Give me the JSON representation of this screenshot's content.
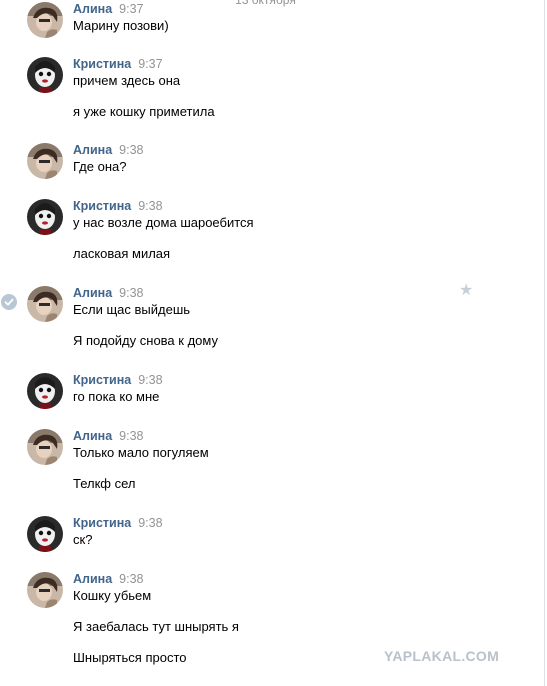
{
  "date_separator": "13 октября",
  "messages": [
    {
      "author": "Алина",
      "time": "9:37",
      "avatar": "alina-avatar",
      "lines": [
        "Марину позови)"
      ]
    },
    {
      "author": "Кристина",
      "time": "9:37",
      "avatar": "kristina-avatar",
      "lines": [
        "причем здесь она",
        "я уже кошку приметила"
      ]
    },
    {
      "author": "Алина",
      "time": "9:38",
      "avatar": "alina-avatar",
      "lines": [
        "Где она?"
      ]
    },
    {
      "author": "Кристина",
      "time": "9:38",
      "avatar": "kristina-avatar",
      "lines": [
        "у нас возле дома шароебится",
        "ласковая милая"
      ]
    },
    {
      "author": "Алина",
      "time": "9:38",
      "avatar": "alina-avatar",
      "lines": [
        "Если щас выйдешь",
        "Я подойду снова к дому"
      ]
    },
    {
      "author": "Кристина",
      "time": "9:38",
      "avatar": "kristina-avatar",
      "lines": [
        "го пока ко мне"
      ]
    },
    {
      "author": "Алина",
      "time": "9:38",
      "avatar": "alina-avatar",
      "lines": [
        "Только мало погуляем",
        "Телкф сел"
      ]
    },
    {
      "author": "Кристина",
      "time": "9:38",
      "avatar": "kristina-avatar",
      "lines": [
        "ск?"
      ]
    },
    {
      "author": "Алина",
      "time": "9:38",
      "avatar": "alina-avatar",
      "lines": [
        "Кошку убьем",
        "Я заебалась тут шнырять я",
        "Шныряться просто"
      ]
    }
  ],
  "icons": {
    "selected_check": "check-circle-icon",
    "favorite": "star-icon"
  },
  "watermark": "YAPLAKAL.COM",
  "colors": {
    "author": "#42648b",
    "time": "#939393",
    "text": "#000000",
    "watermark": "#b8c2cc"
  }
}
